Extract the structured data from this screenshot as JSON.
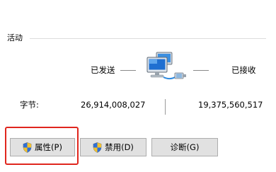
{
  "activity": {
    "section_title": "活动",
    "sent_label": "已发送",
    "received_label": "已接收",
    "bytes_label": "字节:",
    "bytes_sent": "26,914,008,027",
    "bytes_received": "19,375,560,517",
    "icon": "network-computer-icon"
  },
  "buttons": {
    "properties": "属性(P)",
    "disable": "禁用(D)",
    "diagnose": "诊断(G)",
    "shield_icon": "uac-shield-icon"
  },
  "colors": {
    "highlight": "#e0261e",
    "button_bg": "#e1e1e1"
  }
}
